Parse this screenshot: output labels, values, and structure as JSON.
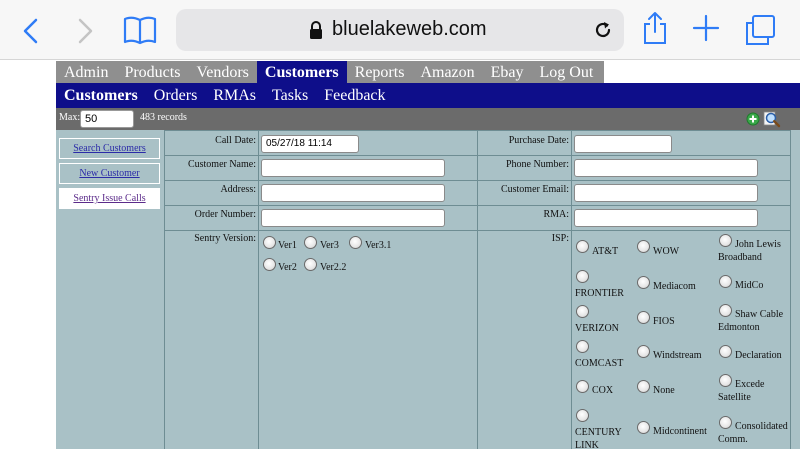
{
  "browser": {
    "url": "bluelakeweb.com"
  },
  "topnav": [
    {
      "label": "Admin"
    },
    {
      "label": "Products"
    },
    {
      "label": "Vendors"
    },
    {
      "label": "Customers"
    },
    {
      "label": "Reports"
    },
    {
      "label": "Amazon"
    },
    {
      "label": "Ebay"
    },
    {
      "label": "Log Out"
    }
  ],
  "subnav": [
    {
      "label": "Customers"
    },
    {
      "label": "Orders"
    },
    {
      "label": "RMAs"
    },
    {
      "label": "Tasks"
    },
    {
      "label": "Feedback"
    }
  ],
  "toolbar": {
    "max_label": "Max:",
    "max_value": "50",
    "records": "483 records"
  },
  "sidebar": [
    {
      "label": "Search Customers"
    },
    {
      "label": "New Customer"
    },
    {
      "label": "Sentry Issue Calls"
    }
  ],
  "form": {
    "call_date": {
      "label": "Call Date:",
      "value": "05/27/18 11:14"
    },
    "purchase_date": {
      "label": "Purchase Date:",
      "value": ""
    },
    "customer_name": {
      "label": "Customer Name:",
      "value": ""
    },
    "phone_number": {
      "label": "Phone Number:",
      "value": ""
    },
    "address": {
      "label": "Address:",
      "value": ""
    },
    "customer_email": {
      "label": "Customer Email:",
      "value": ""
    },
    "order_number": {
      "label": "Order Number:",
      "value": ""
    },
    "rma": {
      "label": "RMA:",
      "value": ""
    },
    "sentry_version": {
      "label": "Sentry Version:",
      "options": [
        "Ver1",
        "Ver3",
        "Ver3.1",
        "Ver2",
        "Ver2.2"
      ]
    },
    "isp": {
      "label": "ISP:",
      "options": [
        "AT&T",
        "WOW",
        "John Lewis Broadband",
        "FRONTIER",
        "Mediacom",
        "MidCo",
        "VERIZON",
        "FIOS",
        "Shaw Cable Edmonton",
        "COMCAST",
        "Windstream",
        "Declaration",
        "COX",
        "None",
        "Excede Satellite",
        "CENTURY LINK",
        "Midcontinent",
        "Consolidated Comm."
      ]
    }
  },
  "colors": {
    "nav_active": "#0e0e8a",
    "nav_bg": "#8f8f8f",
    "panel_bg": "#a9c1c6",
    "browser_accent": "#2f7cf6"
  }
}
